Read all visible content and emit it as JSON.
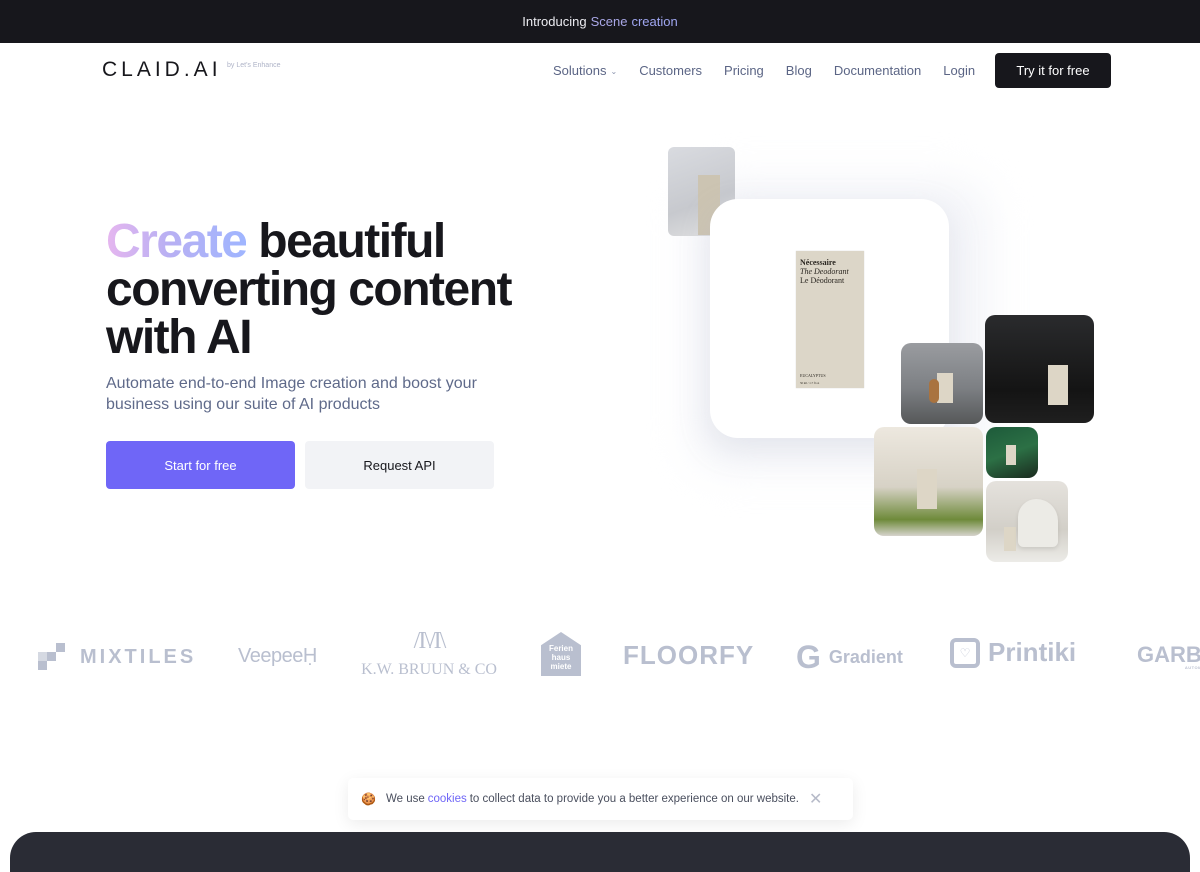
{
  "announcement": {
    "prefix": "Introducing",
    "highlight_1": "Scene",
    "highlight_2": "creation"
  },
  "nav": {
    "logo": "CLAID.AI",
    "logo_sub": "by Let's Enhance",
    "links": [
      {
        "label": "Solutions",
        "has_dropdown": true
      },
      {
        "label": "Customers"
      },
      {
        "label": "Pricing"
      },
      {
        "label": "Blog"
      },
      {
        "label": "Documentation"
      },
      {
        "label": "Login"
      }
    ],
    "cta": "Try it for free"
  },
  "hero": {
    "title_highlight": "Create",
    "title_rest_line1": "beautiful",
    "title_line2": "converting content",
    "title_line3": "with AI",
    "subtitle": "Automate end-to-end Image creation and boost your business using our suite of AI products",
    "primary_button": "Start for free",
    "secondary_button": "Request API",
    "product": {
      "brand": "Nécessaire",
      "line1": "The Deodorant",
      "line2": "Le Déodorant",
      "variant": "EUCALYPTUS",
      "size": "50 ml / 1.7 fl oz"
    }
  },
  "logos": [
    {
      "name": "MIXTILES"
    },
    {
      "name": "Veepee"
    },
    {
      "name": "K.W. BRUUN & CO"
    },
    {
      "name": "Ferien Haus Miete"
    },
    {
      "name": "FLOORFY"
    },
    {
      "name": "Gradient"
    },
    {
      "name": "Printiki"
    },
    {
      "name": "GARBE",
      "sub": "AUTOMOTIVE"
    }
  ],
  "cookie_banner": {
    "icon": "cookie-icon",
    "text_before": "We use",
    "link": "cookies",
    "text_after": "to collect data to provide you a better experience on our website.",
    "close": "✕"
  },
  "colors": {
    "accent": "#6f66f7",
    "dark": "#17171c",
    "muted_text": "#5f6a8a",
    "logo_gray": "#b9bfcf"
  }
}
